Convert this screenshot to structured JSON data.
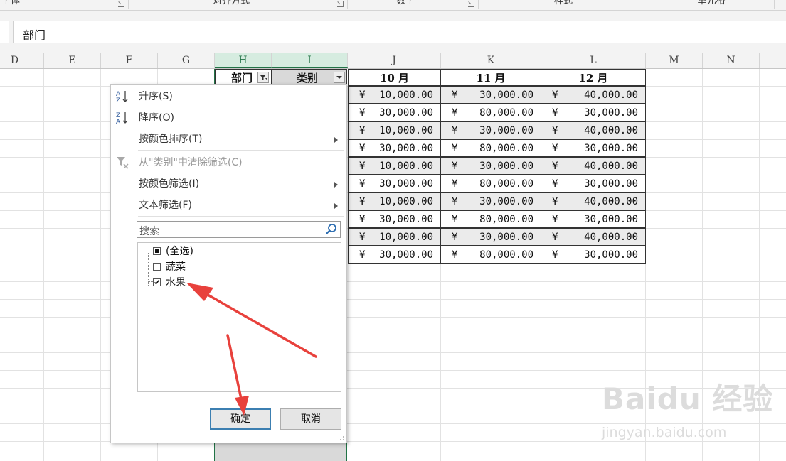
{
  "ribbon": {
    "groups": [
      "字体",
      "对齐方式",
      "数字",
      "样式",
      "单元格"
    ]
  },
  "formula_bar": {
    "value": "部门"
  },
  "columns": [
    "D",
    "E",
    "F",
    "G",
    "H",
    "I",
    "J",
    "K",
    "L",
    "M",
    "N"
  ],
  "table": {
    "headers": {
      "h": "部门",
      "i": "类别",
      "j": "10 月",
      "k": "11 月",
      "l": "12 月"
    },
    "currency": "¥",
    "rows": [
      [
        "10,000.00",
        "30,000.00",
        "40,000.00"
      ],
      [
        "30,000.00",
        "80,000.00",
        "30,000.00"
      ],
      [
        "10,000.00",
        "30,000.00",
        "40,000.00"
      ],
      [
        "30,000.00",
        "80,000.00",
        "30,000.00"
      ],
      [
        "10,000.00",
        "30,000.00",
        "40,000.00"
      ],
      [
        "30,000.00",
        "80,000.00",
        "30,000.00"
      ],
      [
        "10,000.00",
        "30,000.00",
        "40,000.00"
      ],
      [
        "30,000.00",
        "80,000.00",
        "30,000.00"
      ],
      [
        "10,000.00",
        "30,000.00",
        "40,000.00"
      ],
      [
        "30,000.00",
        "80,000.00",
        "30,000.00"
      ]
    ]
  },
  "filter_menu": {
    "sort_asc": "升序(S)",
    "sort_desc": "降序(O)",
    "sort_by_color": "按颜色排序(T)",
    "clear_filter": "从\"类别\"中清除筛选(C)",
    "filter_by_color": "按颜色筛选(I)",
    "text_filter": "文本筛选(F)",
    "search_placeholder": "搜索",
    "items": [
      {
        "label": "(全选)",
        "state": "partial"
      },
      {
        "label": "蔬菜",
        "state": "unchecked"
      },
      {
        "label": "水果",
        "state": "checked"
      }
    ],
    "ok": "确定",
    "cancel": "取消"
  },
  "watermark": {
    "brand": "Baidu 经验",
    "url": "jingyan.baidu.com"
  },
  "colors": {
    "accent": "#217346",
    "annotation": "#e8413c",
    "ok_border": "#3c7fb1"
  }
}
